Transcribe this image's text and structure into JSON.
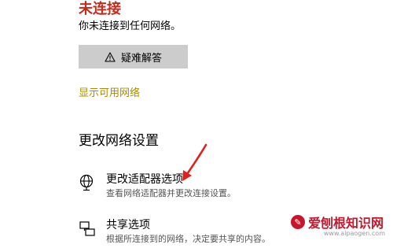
{
  "status": {
    "title": "未连接",
    "description": "你未连接到任何网络。"
  },
  "troubleshoot_button": {
    "label": "疑难解答",
    "icon": "warning-triangle-icon"
  },
  "show_networks_link": "显示可用网络",
  "section": {
    "heading": "更改网络设置"
  },
  "settings": [
    {
      "title": "更改适配器选项",
      "description": "查看网络适配器并更改连接设置。",
      "icon": "adapter-globe-icon"
    },
    {
      "title": "共享选项",
      "description": "根据所连接到的网络，决定要共享的内容。",
      "icon": "sharing-icon"
    }
  ],
  "watermark": {
    "text": "爱刨根知识网",
    "sub": "www.aipaogen.com"
  },
  "colors": {
    "not_connected": "#c42b1c",
    "link": "#a98b00",
    "button_bg": "#cccccc",
    "annotation_arrow": "#e0211b"
  }
}
